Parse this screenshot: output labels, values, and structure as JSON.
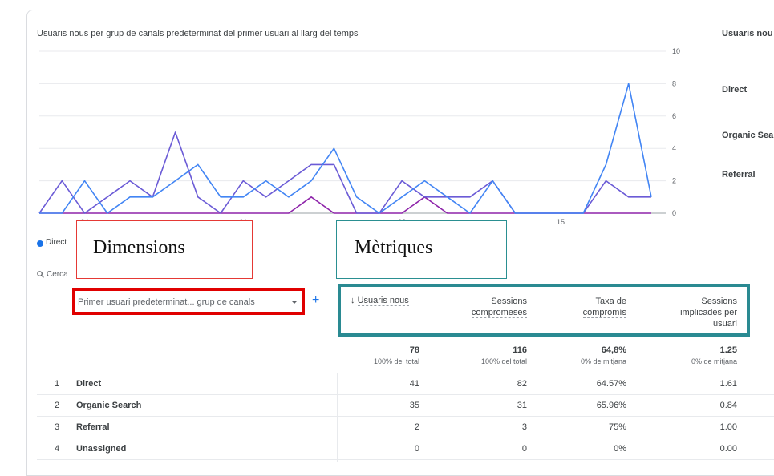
{
  "chart": {
    "title": "Usuaris nous per grup de canals predeterminat del primer usuari al llarg del temps",
    "right_title": "Usuaris nou",
    "y_ticks": [
      "10",
      "8",
      "6",
      "4",
      "2",
      "0"
    ],
    "x_ticks": [
      "24",
      "01",
      "08",
      "15"
    ],
    "right_legend": [
      "Direct",
      "Organic Sear",
      "Referral"
    ],
    "legend_bottom": "Direct"
  },
  "chart_data": {
    "type": "line",
    "x": [
      1,
      2,
      3,
      4,
      5,
      6,
      7,
      8,
      9,
      10,
      11,
      12,
      13,
      14,
      15,
      16,
      17,
      18,
      19,
      20,
      21,
      22,
      23,
      24,
      25,
      26,
      27,
      28
    ],
    "series": [
      {
        "name": "Direct",
        "color": "#4285f4",
        "values": [
          0,
          0,
          2,
          0,
          1,
          1,
          2,
          3,
          1,
          1,
          2,
          1,
          2,
          4,
          1,
          0,
          1,
          2,
          1,
          0,
          2,
          0,
          0,
          0,
          0,
          3,
          8,
          1
        ]
      },
      {
        "name": "Organic Search",
        "color": "#6b5bd6",
        "values": [
          0,
          2,
          0,
          1,
          2,
          1,
          5,
          1,
          0,
          2,
          1,
          2,
          3,
          3,
          0,
          0,
          2,
          1,
          1,
          1,
          2,
          0,
          0,
          0,
          0,
          2,
          1,
          1
        ]
      },
      {
        "name": "Referral",
        "color": "#8e24aa",
        "values": [
          0,
          0,
          0,
          0,
          0,
          0,
          0,
          0,
          0,
          0,
          0,
          0,
          1,
          0,
          0,
          0,
          0,
          1,
          0,
          0,
          0,
          0,
          0,
          0,
          0,
          0,
          0,
          0
        ]
      }
    ],
    "ylim": [
      0,
      10
    ]
  },
  "annotations": {
    "dimensions": "Dimensions",
    "metrics": "Mètriques"
  },
  "search": {
    "placeholder": "Cerca"
  },
  "table": {
    "dimension_selector": "Primer usuari predeterminat... grup de canals",
    "add_label": "+",
    "columns": [
      {
        "label_lines": [
          "Usuaris nous"
        ],
        "sorted": true,
        "sort_arrow": "↓"
      },
      {
        "label_lines": [
          "Sessions",
          "compromeses"
        ]
      },
      {
        "label_lines": [
          "Taxa de",
          "compromís"
        ]
      },
      {
        "label_lines": [
          "Sessions",
          "implicades per",
          "usuari"
        ]
      }
    ],
    "totals": [
      {
        "value": "78",
        "sub": "100% del total"
      },
      {
        "value": "116",
        "sub": "100% del total"
      },
      {
        "value": "64,8%",
        "sub": "0% de mitjana"
      },
      {
        "value": "1.25",
        "sub": "0% de mitjana"
      }
    ],
    "rows": [
      {
        "index": "1",
        "name": "Direct",
        "cells": [
          "41",
          "82",
          "64.57%",
          "1.61"
        ]
      },
      {
        "index": "2",
        "name": "Organic Search",
        "cells": [
          "35",
          "31",
          "65.96%",
          "0.84"
        ]
      },
      {
        "index": "3",
        "name": "Referral",
        "cells": [
          "2",
          "3",
          "75%",
          "1.00"
        ]
      },
      {
        "index": "4",
        "name": "Unassigned",
        "cells": [
          "0",
          "0",
          "0%",
          "0.00"
        ]
      }
    ]
  }
}
